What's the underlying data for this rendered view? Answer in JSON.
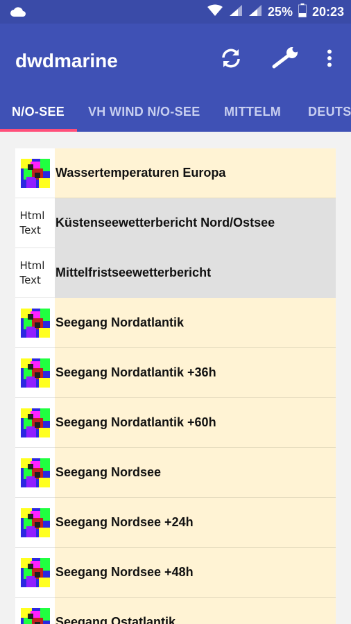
{
  "status_bar": {
    "battery_percent": "25%",
    "time": "20:23"
  },
  "app_bar": {
    "title": "dwdmarine",
    "color": "#3f51b5",
    "actions": [
      {
        "icon": "refresh-icon"
      },
      {
        "icon": "wrench-icon"
      },
      {
        "icon": "more-vert-icon"
      }
    ]
  },
  "tabs": [
    {
      "label": "N/O-SEE",
      "active": true
    },
    {
      "label": "VH WIND N/O-SEE",
      "active": false
    },
    {
      "label": "MITTELM",
      "active": false
    },
    {
      "label": "DEUTSC",
      "active": false
    }
  ],
  "list": {
    "items": [
      {
        "type": "image",
        "title": "Wassertemperaturen Europa"
      },
      {
        "type": "html-text",
        "icon_text": "Html Text",
        "title": "Küstenseewetterbericht Nord/Ostsee"
      },
      {
        "type": "html-text",
        "icon_text": "Html Text",
        "title": "Mittelfristseewetterbericht"
      },
      {
        "type": "image",
        "title": "Seegang Nordatlantik"
      },
      {
        "type": "image",
        "title": "Seegang Nordatlantik +36h"
      },
      {
        "type": "image",
        "title": "Seegang Nordatlantik +60h"
      },
      {
        "type": "image",
        "title": "Seegang Nordsee"
      },
      {
        "type": "image",
        "title": "Seegang Nordsee +24h"
      },
      {
        "type": "image",
        "title": "Seegang Nordsee +48h"
      },
      {
        "type": "image",
        "title": "Seegang Ostatlantik"
      }
    ]
  }
}
